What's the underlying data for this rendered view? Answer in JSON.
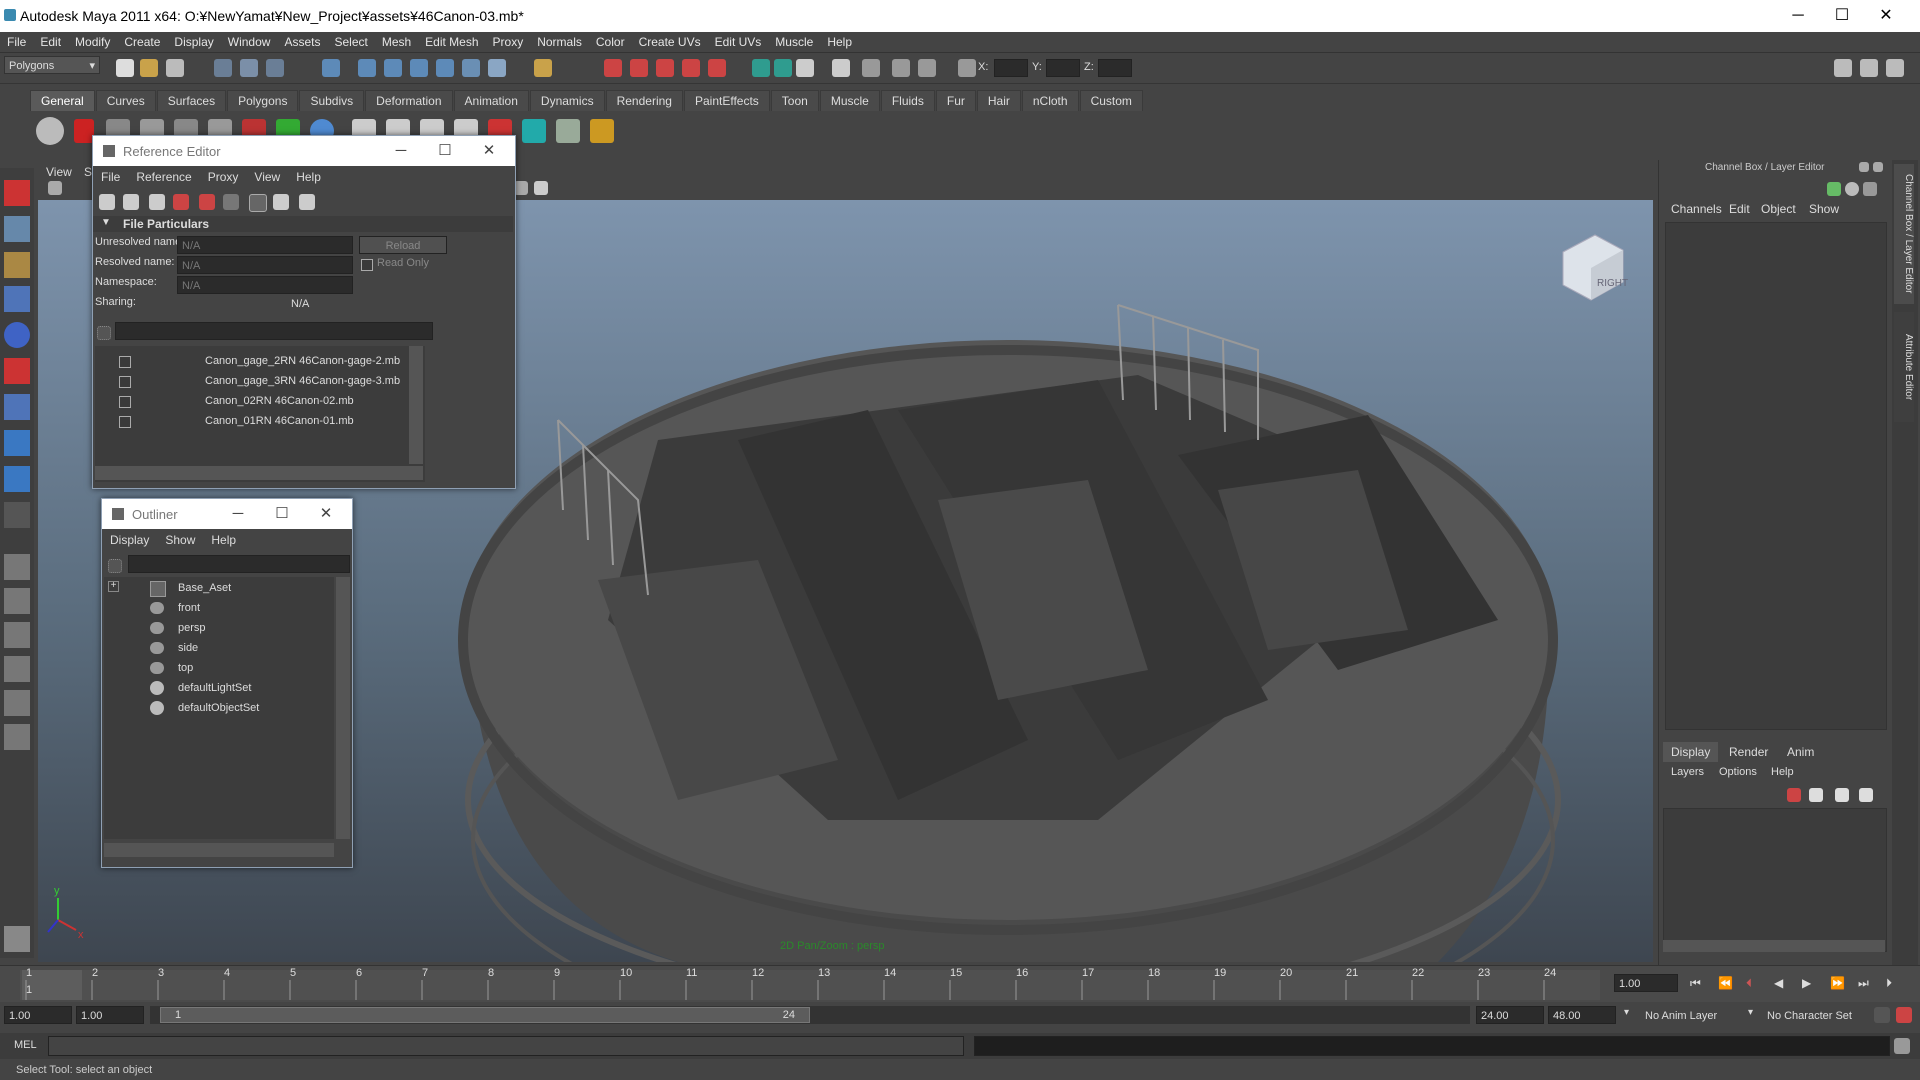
{
  "app": {
    "title": "Autodesk Maya 2011 x64: O:¥NewYamat¥New_Project¥assets¥46Canon-03.mb*",
    "minimize": "─",
    "maximize": "☐",
    "close": "✕"
  },
  "menu": [
    "File",
    "Edit",
    "Modify",
    "Create",
    "Display",
    "Window",
    "Assets",
    "Select",
    "Mesh",
    "Edit Mesh",
    "Proxy",
    "Normals",
    "Color",
    "Create UVs",
    "Edit UVs",
    "Muscle",
    "Help"
  ],
  "status": {
    "mode": "Polygons",
    "x_label": "X:",
    "y_label": "Y:",
    "z_label": "Z:"
  },
  "shelf_tabs": [
    "General",
    "Curves",
    "Surfaces",
    "Polygons",
    "Subdivs",
    "Deformation",
    "Animation",
    "Dynamics",
    "Rendering",
    "PaintEffects",
    "Toon",
    "Muscle",
    "Fluids",
    "Fur",
    "Hair",
    "nCloth",
    "Custom"
  ],
  "viewport": {
    "menu": [
      "View",
      "Sh"
    ],
    "hud": "2D Pan/Zoom : persp",
    "cube_label": "RIGHT",
    "axis_y": "y",
    "axis_x": "x"
  },
  "reference_editor": {
    "title": "Reference Editor",
    "menu": [
      "File",
      "Reference",
      "Proxy",
      "View",
      "Help"
    ],
    "section": "File Particulars",
    "unresolved_label": "Unresolved name:",
    "unresolved_value": "N/A",
    "resolved_label": "Resolved name:",
    "resolved_value": "N/A",
    "namespace_label": "Namespace:",
    "namespace_value": "N/A",
    "sharing_label": "Sharing:",
    "sharing_value": "N/A",
    "reload": "Reload",
    "readonly": "Read Only",
    "refs": [
      "Canon_gage_2RN 46Canon-gage-2.mb",
      "Canon_gage_3RN 46Canon-gage-3.mb",
      "Canon_02RN 46Canon-02.mb",
      "Canon_01RN 46Canon-01.mb"
    ]
  },
  "outliner": {
    "title": "Outliner",
    "menu": [
      "Display",
      "Show",
      "Help"
    ],
    "items": [
      "Base_Aset",
      "front",
      "persp",
      "side",
      "top",
      "defaultLightSet",
      "defaultObjectSet"
    ]
  },
  "channel_box": {
    "title": "Channel Box / Layer Editor",
    "menu": [
      "Channels",
      "Edit",
      "Object",
      "Show"
    ],
    "layer_tabs": [
      "Display",
      "Render",
      "Anim"
    ],
    "layer_menu": [
      "Layers",
      "Options",
      "Help"
    ],
    "side_tab1": "Channel Box / Layer Editor",
    "side_tab2": "Attribute Editor"
  },
  "timeline": {
    "ticks": [
      "1",
      "2",
      "3",
      "4",
      "5",
      "6",
      "7",
      "8",
      "9",
      "10",
      "11",
      "12",
      "13",
      "14",
      "15",
      "16",
      "17",
      "18",
      "19",
      "20",
      "21",
      "22",
      "23",
      "24"
    ],
    "current_frame": "1.00",
    "start_field": "1.00",
    "start_field2": "1.00",
    "range_start": "1",
    "range_end": "24",
    "end_field": "24.00",
    "end_field2": "48.00",
    "anim_layer": "No Anim Layer",
    "char_set": "No Character Set"
  },
  "mel_label": "MEL",
  "help_line": "Select Tool: select an object"
}
